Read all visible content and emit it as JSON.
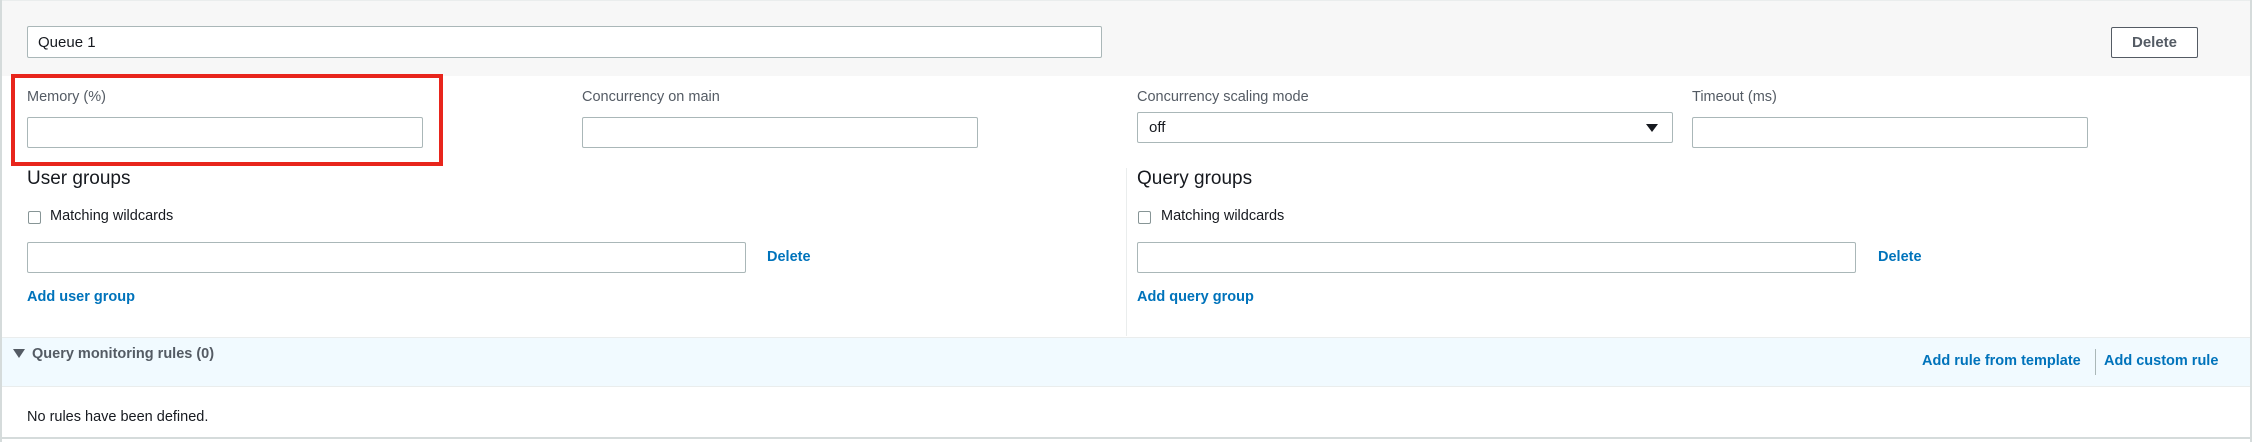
{
  "queue": {
    "name_value": "Queue 1",
    "delete_label": "Delete"
  },
  "fields": {
    "memory_label": "Memory (%)",
    "memory_value": "",
    "concurrency_label": "Concurrency on main",
    "concurrency_value": "",
    "scaling_label": "Concurrency scaling mode",
    "scaling_value": "off",
    "timeout_label": "Timeout (ms)",
    "timeout_value": ""
  },
  "user_groups": {
    "title": "User groups",
    "wildcards_label": "Matching wildcards",
    "wildcards_checked": false,
    "group_value": "",
    "delete_label": "Delete",
    "add_label": "Add user group"
  },
  "query_groups": {
    "title": "Query groups",
    "wildcards_label": "Matching wildcards",
    "wildcards_checked": false,
    "group_value": "",
    "delete_label": "Delete",
    "add_label": "Add query group"
  },
  "monitoring": {
    "title": "Query monitoring rules (0)",
    "add_template_label": "Add rule from template",
    "add_custom_label": "Add custom rule",
    "empty_text": "No rules have been defined."
  },
  "colors": {
    "link": "#0073bb",
    "highlight": "#e8251c",
    "header_bg": "#f7f7f7",
    "qmr_bg": "#f1faff"
  }
}
